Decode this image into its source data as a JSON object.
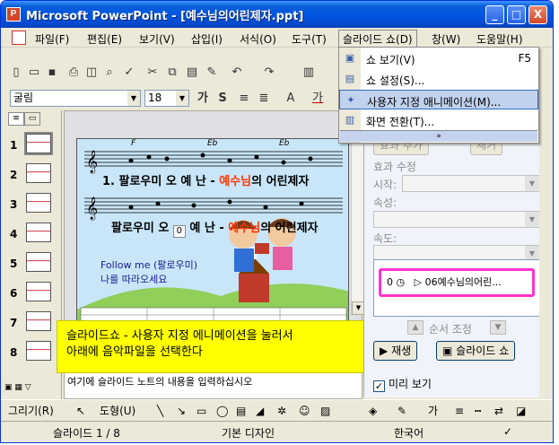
{
  "window": {
    "title": "Microsoft PowerPoint - [예수님의어린제자.ppt]",
    "icon_label": "P",
    "minimize": "_",
    "maximize": "□",
    "close": "X"
  },
  "menu": {
    "items": [
      "파일(F)",
      "편집(E)",
      "보기(V)",
      "삽입(I)",
      "서식(O)",
      "도구(T)",
      "슬라이드 쇼(D)",
      "창(W)",
      "도움말(H)"
    ],
    "open_menu": "슬라이드 쇼(D)"
  },
  "toolbar": {
    "font_name": "굴림",
    "font_size": "18",
    "bold_label": "가",
    "shadow_label": "S",
    "font_color_label": "가"
  },
  "dropdown": {
    "items": [
      {
        "label": "쇼 보기(V)",
        "shortcut": "F5",
        "icon": "slideshow-icon"
      },
      {
        "label": "쇼 설정(S)...",
        "shortcut": "",
        "icon": "setup-show-icon"
      },
      {
        "label": "사용자 지정 애니메이션(M)...",
        "shortcut": "",
        "icon": "custom-animation-icon",
        "highlighted": true
      },
      {
        "label": "화면 전환(T)...",
        "shortcut": "",
        "icon": "transition-icon"
      }
    ],
    "expand_glyph": "»"
  },
  "slides_pane": {
    "numbers": [
      "1",
      "2",
      "3",
      "4",
      "5",
      "6",
      "7",
      "8"
    ],
    "selected": "1"
  },
  "slide": {
    "chord_labels": [
      "F",
      "Eb",
      "Eb"
    ],
    "line1_prefix": "1. 팔로우미 오 예 난 - ",
    "line1_highlight": "예수님",
    "line1_suffix": "의 어린제자",
    "line2_prefix": "팔로우미 오",
    "line2_mid": "예 난 - ",
    "line2_highlight": "예수님",
    "line2_suffix": "의 어린제자",
    "sound_marker": "0",
    "follow_line1": "Follow me (팔로우미)",
    "follow_line2": "나를 따라오세요"
  },
  "callout": {
    "line1": "슬라이드쇼 - 사용자 지정 에니메이션을 눌러서",
    "line2": "아래에 음악파일을 선택한다"
  },
  "notes": {
    "text": "여기에 슬라이드 노트의 내용을 입력하십시오"
  },
  "task_pane": {
    "top_buttons": [
      "효과 추가",
      "제거"
    ],
    "effect_modify": "효과 수정",
    "start_label": "시작:",
    "property_label": "속성:",
    "speed_label": "속도:",
    "list_item_index": "0",
    "list_item_name": "06예수님의어린...",
    "reorder_label": "순서 조정",
    "play_button": "재생",
    "slideshow_button": "슬라이드 쇼",
    "preview_checkbox": "미리 보기",
    "preview_checked": true
  },
  "draw_toolbar": {
    "draw_label": "그리기(R)",
    "autoshape_label": "도형(U)"
  },
  "status": {
    "slide_pos": "슬라이드 1 / 8",
    "design": "기본 디자인",
    "language": "한국어"
  },
  "colors": {
    "titlebar": "#0054e3",
    "callout": "#ffff00",
    "highlight_text": "#ff3300",
    "list_border": "#ff33cc"
  }
}
